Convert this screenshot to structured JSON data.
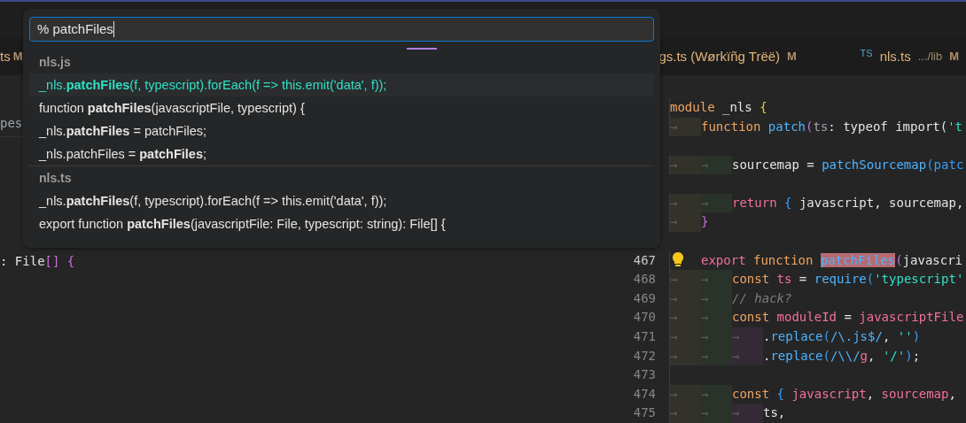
{
  "tabs": [
    {
      "label": "ts",
      "status": "M"
    },
    {
      "label": "gs.ts (Wørkïñg Trëë)",
      "status": "M"
    },
    {
      "label": "nls.ts",
      "path": ".../lib",
      "status": "M",
      "badge": "TS"
    }
  ],
  "left_editor": {
    "lines": [
      {
        "tokens": [
          {
            "text": "pes",
            "kind": "param"
          }
        ]
      },
      {
        "tokens": [
          {
            "text": ": File",
            "kind": "plain"
          },
          {
            "text": "[]",
            "kind": "bracket2"
          },
          {
            "text": " {",
            "kind": "bracket2"
          }
        ]
      }
    ]
  },
  "right_editor": {
    "lines": [
      {
        "tokens": [
          {
            "text": "module",
            "kind": "kw"
          },
          {
            "text": " _nls ",
            "kind": "plain"
          },
          {
            "text": "{",
            "kind": "bracket1"
          }
        ]
      },
      {
        "tokens": [
          {
            "text": "→",
            "kind": "tab"
          },
          {
            "text": "function ",
            "kind": "kw"
          },
          {
            "text": "patch",
            "kind": "fn"
          },
          {
            "text": "(",
            "kind": "bracket2"
          },
          {
            "text": "ts",
            "kind": "param"
          },
          {
            "text": ": typeof import(",
            "kind": "plain"
          },
          {
            "text": "'t",
            "kind": "str"
          }
        ]
      },
      {
        "kind": "blank"
      },
      {
        "tokens": [
          {
            "text": "→",
            "kind": "tab"
          },
          {
            "text": "→",
            "kind": "tab"
          },
          {
            "text": "sourcemap = ",
            "kind": "plain"
          },
          {
            "text": "patchSourcemap",
            "kind": "fn"
          },
          {
            "text": "(patc",
            "kind": "bracket3"
          }
        ]
      },
      {
        "kind": "blank"
      },
      {
        "tokens": [
          {
            "text": "→",
            "kind": "tab"
          },
          {
            "text": "→",
            "kind": "tab"
          },
          {
            "text": "return",
            "kind": "ctrl"
          },
          {
            "text": " { ",
            "kind": "bracket3"
          },
          {
            "text": "javascript, sourcemap,",
            "kind": "plain"
          }
        ]
      },
      {
        "tokens": [
          {
            "text": "→",
            "kind": "tab"
          },
          {
            "text": "}",
            "kind": "bracket2"
          }
        ]
      },
      {
        "kind": "blank"
      },
      {
        "number": "467",
        "lightbulb": true,
        "tokens": [
          {
            "text": "export ",
            "kind": "ctrl"
          },
          {
            "text": "function ",
            "kind": "kw"
          },
          {
            "text": "patchFiles",
            "kind": "match"
          },
          {
            "text": "(",
            "kind": "bracket2"
          },
          {
            "text": "javascri",
            "kind": "plain"
          }
        ]
      },
      {
        "number": "468",
        "lightbulb": false,
        "tokens": [
          {
            "text": "→",
            "kind": "tab"
          },
          {
            "text": "→",
            "kind": "tab"
          },
          {
            "text": "const ",
            "kind": "kw"
          },
          {
            "text": "ts",
            "kind": "var"
          },
          {
            "text": " = ",
            "kind": "plain"
          },
          {
            "text": "require",
            "kind": "fn"
          },
          {
            "text": "(",
            "kind": "bracket3"
          },
          {
            "text": "'typescript'",
            "kind": "str"
          }
        ]
      },
      {
        "number": "469",
        "lightbulb": false,
        "tokens": [
          {
            "text": "→",
            "kind": "tab"
          },
          {
            "text": "→",
            "kind": "tab"
          },
          {
            "text": "// hack?",
            "kind": "comment"
          }
        ]
      },
      {
        "number": "470",
        "lightbulb": false,
        "tokens": [
          {
            "text": "→",
            "kind": "tab"
          },
          {
            "text": "→",
            "kind": "tab"
          },
          {
            "text": "const ",
            "kind": "kw"
          },
          {
            "text": "moduleId",
            "kind": "var"
          },
          {
            "text": " = ",
            "kind": "plain"
          },
          {
            "text": "javascriptFile",
            "kind": "var"
          }
        ]
      },
      {
        "number": "471",
        "lightbulb": false,
        "tokens": [
          {
            "text": "→",
            "kind": "tab"
          },
          {
            "text": "→",
            "kind": "tab"
          },
          {
            "text": "→",
            "kind": "tab"
          },
          {
            "text": ".",
            "kind": "plain"
          },
          {
            "text": "replace",
            "kind": "fn"
          },
          {
            "text": "(",
            "kind": "bracket3"
          },
          {
            "text": "/\\.js$/",
            "kind": "regex"
          },
          {
            "text": ", ",
            "kind": "plain"
          },
          {
            "text": "''",
            "kind": "str"
          },
          {
            "text": ")",
            "kind": "bracket3"
          }
        ]
      },
      {
        "number": "472",
        "lightbulb": false,
        "tokens": [
          {
            "text": "→",
            "kind": "tab"
          },
          {
            "text": "→",
            "kind": "tab"
          },
          {
            "text": "→",
            "kind": "tab"
          },
          {
            "text": ".",
            "kind": "plain"
          },
          {
            "text": "replace",
            "kind": "fn"
          },
          {
            "text": "(",
            "kind": "bracket3"
          },
          {
            "text": "/\\\\/",
            "kind": "regex"
          },
          {
            "text": "g",
            "kind": "var"
          },
          {
            "text": ", ",
            "kind": "plain"
          },
          {
            "text": "'/'",
            "kind": "str"
          },
          {
            "text": ")",
            "kind": "bracket3"
          },
          {
            "text": ";",
            "kind": "plain"
          }
        ]
      },
      {
        "number": "473",
        "lightbulb": false
      },
      {
        "number": "474",
        "lightbulb": false,
        "tokens": [
          {
            "text": "→",
            "kind": "tab"
          },
          {
            "text": "→",
            "kind": "tab"
          },
          {
            "text": "const ",
            "kind": "kw"
          },
          {
            "text": "{ ",
            "kind": "bracket3"
          },
          {
            "text": "javascript",
            "kind": "var"
          },
          {
            "text": ", ",
            "kind": "plain"
          },
          {
            "text": "sourcemap",
            "kind": "var"
          },
          {
            "text": ",",
            "kind": "plain"
          }
        ]
      },
      {
        "number": "475",
        "lightbulb": false,
        "tokens": [
          {
            "text": "→",
            "kind": "tab"
          },
          {
            "text": "→",
            "kind": "tab"
          },
          {
            "text": "→",
            "kind": "tab"
          },
          {
            "text": "ts,",
            "kind": "plain"
          }
        ]
      }
    ]
  },
  "quick_pick": {
    "input": {
      "value": "% patchFiles"
    },
    "busy": true,
    "groups": [
      {
        "label": "nls.js",
        "items": [
          {
            "text": "_nls.**patchFiles**(f, typescript).forEach(f => this.emit('data', f));",
            "selected": true
          },
          {
            "text": "function **patchFiles**(javascriptFile, typescript) {",
            "selected": false
          },
          {
            "text": "_nls.**patchFiles** = patchFiles;",
            "selected": false
          },
          {
            "text": "_nls.patchFiles = **patchFiles**;",
            "selected": false
          }
        ]
      },
      {
        "label": "nls.ts",
        "items": [
          {
            "text": "_nls.**patchFiles**(f, typescript).forEach(f => this.emit('data', f));",
            "selected": false
          },
          {
            "text": "export function **patchFiles**(javascriptFile: File, typescript: string): File[] {",
            "selected": false
          }
        ]
      }
    ]
  }
}
